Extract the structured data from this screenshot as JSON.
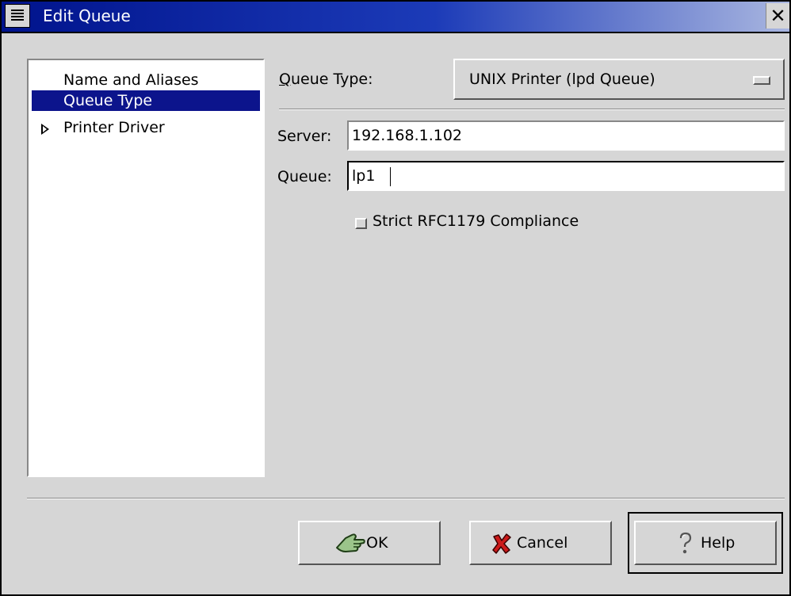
{
  "window": {
    "title": "Edit Queue",
    "close_glyph": "✕",
    "menu_icon": "window-menu-icon",
    "titlebar_color": "#00138c"
  },
  "sidebar": {
    "items": [
      {
        "label": "Name and Aliases",
        "selected": false,
        "expandable": false
      },
      {
        "label": "Queue Type",
        "selected": true,
        "expandable": false
      },
      {
        "label": "Printer Driver",
        "selected": false,
        "expandable": true
      }
    ],
    "selection_color": "#0c148c"
  },
  "main": {
    "queue_type_label": "Queue Type:",
    "queue_type_mnemonic": "Q",
    "queue_type_rest": "ueue Type:",
    "queue_type_value": "UNIX Printer (lpd Queue)",
    "server_label": "Server:",
    "server_value": "192.168.1.102",
    "queue_label": "Queue:",
    "queue_value": "lp1",
    "strict_label": "Strict RFC1179 Compliance",
    "strict_checked": false
  },
  "buttons": {
    "ok_label": "OK",
    "ok_icon": "ok-hand-icon",
    "cancel_label": "Cancel",
    "cancel_icon": "cancel-x-icon",
    "help_label": "Help",
    "help_icon": "help-question-icon"
  }
}
